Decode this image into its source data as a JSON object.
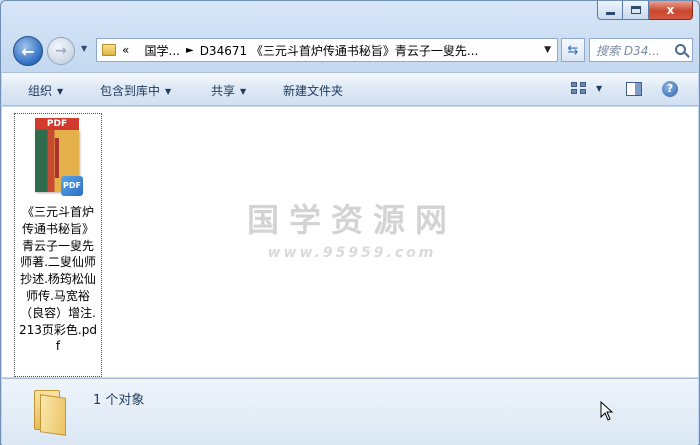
{
  "window": {
    "caption_close": "x"
  },
  "address_bar": {
    "crumb_root_prefix": "«",
    "crumb_parent": "国学...",
    "crumb_current": "D34671 《三元斗首炉传通书秘旨》青云子一叟先...",
    "search_placeholder": "搜索 D34..."
  },
  "toolbar": {
    "organize": "组织",
    "include_in_library": "包含到库中",
    "share": "共享",
    "new_folder": "新建文件夹"
  },
  "file": {
    "pdf_tag": "PDF",
    "badge": "PDF",
    "name": "《三元斗首炉传通书秘旨》青云子一叟先师著.二叟仙师抄述.杨筠松仙师传.马宽裕（良容）增注.213页彩色.pdf"
  },
  "watermark": {
    "title": "国学资源网",
    "url": "www.95959.com"
  },
  "statusbar": {
    "count_text": "1 个对象"
  },
  "colors": {
    "accent": "#2f6cc0",
    "close": "#c9472e",
    "pdf_red": "#d13b2e"
  }
}
